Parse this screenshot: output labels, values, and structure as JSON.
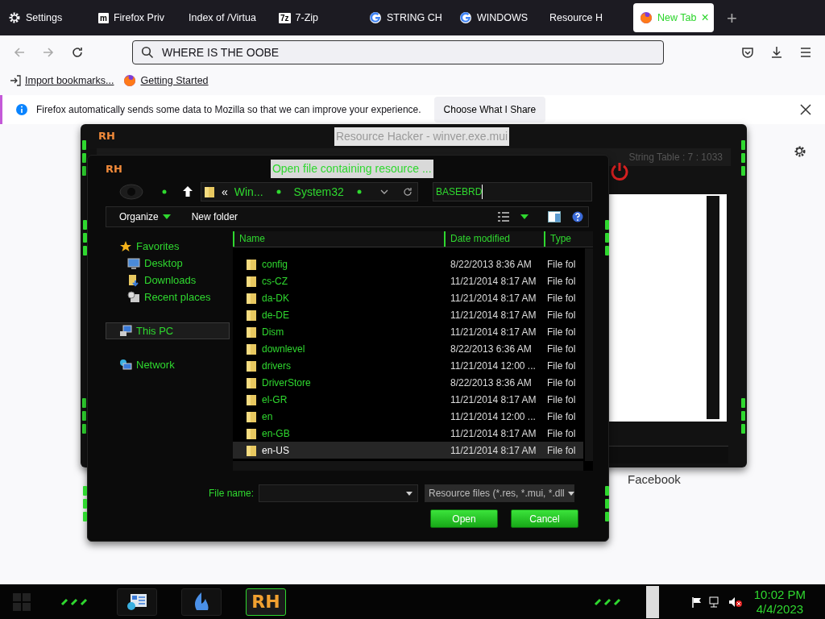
{
  "browser": {
    "tabs": [
      {
        "label": "Settings",
        "kind": "gear",
        "selected": false
      },
      {
        "label": "Firefox Priv",
        "kind": "letter",
        "icon_text": "m",
        "selected": false
      },
      {
        "label": "Index of /Virtua",
        "kind": "plain",
        "selected": false
      },
      {
        "label": "7-Zip",
        "kind": "letter",
        "icon_text": "7z",
        "selected": false
      },
      {
        "label": "STRING CH",
        "kind": "g",
        "selected": false
      },
      {
        "label": "WINDOWS",
        "kind": "g",
        "selected": false
      },
      {
        "label": "Resource H",
        "kind": "plain",
        "selected": false
      },
      {
        "label": "New Tab",
        "kind": "firefox",
        "selected": true,
        "close": "×"
      }
    ],
    "new_tab": "+",
    "address": "WHERE IS THE OOBE",
    "bookmarks": [
      {
        "label": "Import bookmarks...",
        "kind": "import"
      },
      {
        "label": "Getting Started",
        "kind": "firefox"
      }
    ],
    "notification": {
      "text": "Firefox automatically sends some data to Mozilla so that we can improve your experience.",
      "button": "Choose What I Share"
    },
    "background_text": "Facebook"
  },
  "rh_window": {
    "logo": "RH",
    "title": "Resource Hacker - winver.exe.mui",
    "status": "String Table : 7 : 1033"
  },
  "dialog": {
    "logo": "RH",
    "title": "Open file containing resource ...",
    "breadcrumb_prefix": "«",
    "breadcrumb": [
      "Win...",
      "System32"
    ],
    "search_value": "BASEBRD",
    "toolbar": [
      "Organize",
      "New folder"
    ],
    "nav": [
      {
        "label": "Favorites",
        "kind": "star",
        "selected": false,
        "children": [
          {
            "label": "Desktop",
            "kind": "desktop",
            "selected": false
          },
          {
            "label": "Downloads",
            "kind": "downloads",
            "selected": false
          },
          {
            "label": "Recent places",
            "kind": "recent",
            "selected": false
          }
        ]
      },
      {
        "label": "This PC",
        "kind": "pc",
        "selected": true
      },
      {
        "label": "Network",
        "kind": "network",
        "selected": false
      }
    ],
    "columns": [
      "Name",
      "Date modified",
      "Type"
    ],
    "rows": [
      {
        "name": "config",
        "date": "8/22/2013 8:36 AM",
        "type": "File fol",
        "selected": false
      },
      {
        "name": "cs-CZ",
        "date": "11/21/2014 8:17 AM",
        "type": "File fol",
        "selected": false
      },
      {
        "name": "da-DK",
        "date": "11/21/2014 8:17 AM",
        "type": "File fol",
        "selected": false
      },
      {
        "name": "de-DE",
        "date": "11/21/2014 8:17 AM",
        "type": "File fol",
        "selected": false
      },
      {
        "name": "Dism",
        "date": "11/21/2014 8:17 AM",
        "type": "File fol",
        "selected": false
      },
      {
        "name": "downlevel",
        "date": "8/22/2013 6:36 AM",
        "type": "File fol",
        "selected": false
      },
      {
        "name": "drivers",
        "date": "11/21/2014 12:00 ...",
        "type": "File fol",
        "selected": false
      },
      {
        "name": "DriverStore",
        "date": "8/22/2013 8:36 AM",
        "type": "File fol",
        "selected": false
      },
      {
        "name": "el-GR",
        "date": "11/21/2014 8:17 AM",
        "type": "File fol",
        "selected": false
      },
      {
        "name": "en",
        "date": "11/21/2014 12:00 ...",
        "type": "File fol",
        "selected": false
      },
      {
        "name": "en-GB",
        "date": "11/21/2014 8:17 AM",
        "type": "File fol",
        "selected": false
      },
      {
        "name": "en-US",
        "date": "11/21/2014 8:17 AM",
        "type": "File fol",
        "selected": true
      }
    ],
    "file_name_label": "File name:",
    "filter": "Resource files (*.res, *.mui, *.dll",
    "buttons": [
      "Open",
      "Cancel"
    ]
  },
  "taskbar": {
    "apps": [
      {
        "kind": "panel",
        "selected": false
      },
      {
        "kind": "flame",
        "selected": false
      },
      {
        "kind": "logo",
        "text": "RH",
        "selected": true
      }
    ],
    "time": "10:02 PM",
    "date": "4/4/2023"
  }
}
